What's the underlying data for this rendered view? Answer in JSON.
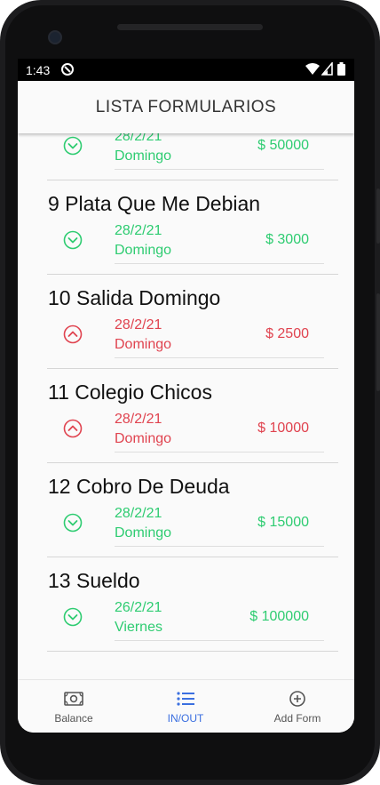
{
  "status_bar": {
    "time": "1:43"
  },
  "app_bar": {
    "title": "LISTA FORMULARIOS"
  },
  "colors": {
    "income": "#2ecc71",
    "expense": "#e0434f",
    "nav_active": "#3b6fe0"
  },
  "forms": [
    {
      "title": "",
      "date": "28/2/21",
      "day": "Domingo",
      "amount": "$ 50000",
      "kind": "income",
      "icon": "chevron-down-circle-icon"
    },
    {
      "title": "9 Plata Que Me Debian",
      "date": "28/2/21",
      "day": "Domingo",
      "amount": "$ 3000",
      "kind": "income",
      "icon": "chevron-down-circle-icon"
    },
    {
      "title": "10 Salida Domingo",
      "date": "28/2/21",
      "day": "Domingo",
      "amount": "$ 2500",
      "kind": "expense",
      "icon": "chevron-up-circle-icon"
    },
    {
      "title": "11 Colegio Chicos",
      "date": "28/2/21",
      "day": "Domingo",
      "amount": "$ 10000",
      "kind": "expense",
      "icon": "chevron-up-circle-icon"
    },
    {
      "title": "12 Cobro De Deuda",
      "date": "28/2/21",
      "day": "Domingo",
      "amount": "$ 15000",
      "kind": "income",
      "icon": "chevron-down-circle-icon"
    },
    {
      "title": "13 Sueldo",
      "date": "26/2/21",
      "day": "Viernes",
      "amount": "$ 100000",
      "kind": "income",
      "icon": "chevron-down-circle-icon"
    }
  ],
  "nav": {
    "items": [
      {
        "label": "Balance",
        "icon": "money-icon",
        "active": false
      },
      {
        "label": "IN/OUT",
        "icon": "list-icon",
        "active": true
      },
      {
        "label": "Add Form",
        "icon": "add-circle-icon",
        "active": false
      }
    ]
  }
}
